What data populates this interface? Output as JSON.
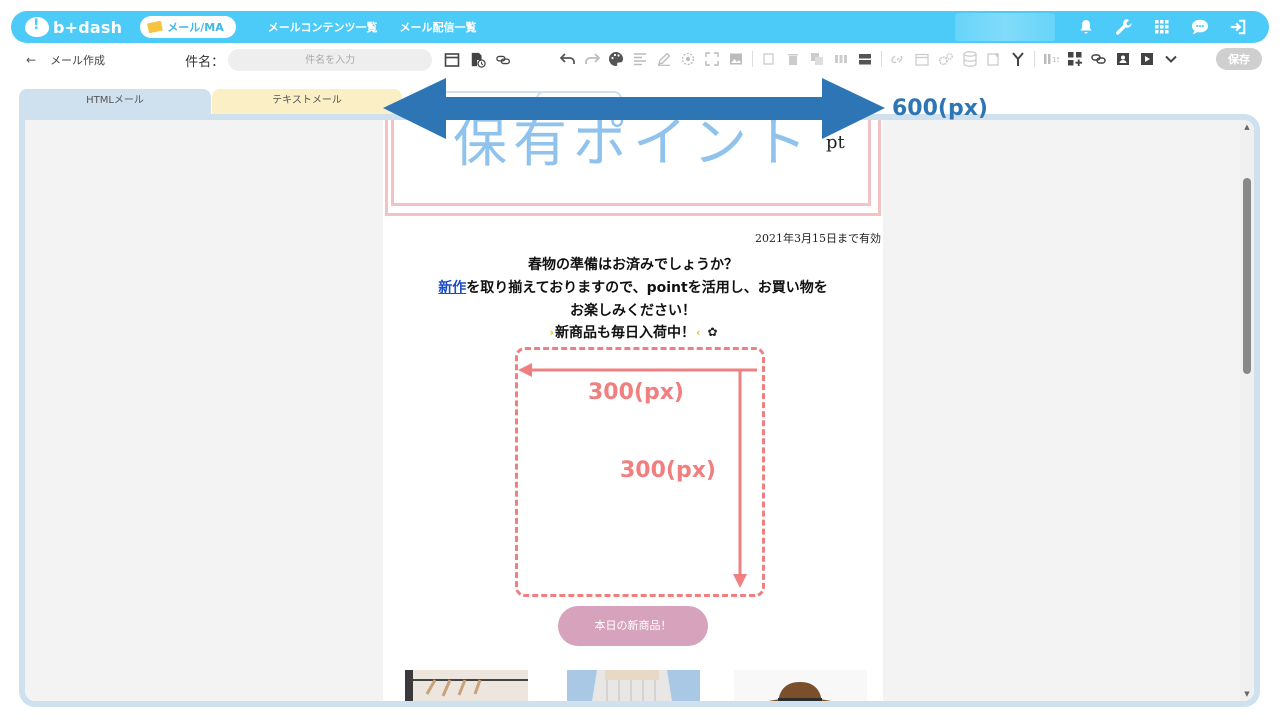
{
  "header": {
    "logo_text": "b+dash",
    "mode_pill": "メール/MA",
    "nav": [
      "メールコンテンツ一覧",
      "メール配信一覧"
    ]
  },
  "toolbar": {
    "back_icon": "arrow-left-icon",
    "breadcrumb": "メール作成",
    "subject_label": "件名：",
    "subject_placeholder": "件名を入力",
    "save_label": "保存"
  },
  "tabs": {
    "html": "HTMLメール",
    "text": "テキストメール"
  },
  "email": {
    "title": "保有ポイント",
    "unit": "pt",
    "valid_until": "2021年3月15日まで有効",
    "line1": "春物の準備はお済みでしょうか？",
    "line2_link": "新作",
    "line2_rest": "を取り揃えておりますので、pointを活用し、お買い物を",
    "line3": "お楽しみください！",
    "line4": "新商品も毎日入荷中！",
    "cta_label": "本日の新商品！"
  },
  "annotations": {
    "width_label": "600(px)",
    "image_width": "300(px)",
    "image_height": "300(px)"
  },
  "colors": {
    "header_bg": "#4ccbf8",
    "tab_html": "#cfe0ee",
    "tab_text": "#fbefc6",
    "title": "#8fc2ec",
    "cta": "#d7a3bc",
    "annotation_blue": "#2e75b6",
    "annotation_red": "#f08080"
  }
}
